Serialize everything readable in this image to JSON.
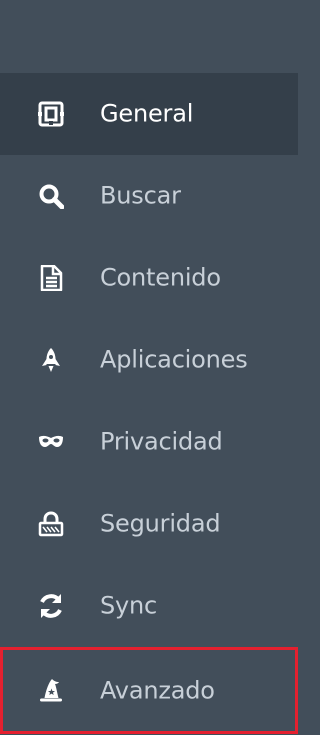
{
  "colors": {
    "sidebar_bg": "#424e5a",
    "selected_bg": "#343f4a",
    "text": "#c8d0d8",
    "selected_text": "#ffffff",
    "highlight_border": "#e4202f"
  },
  "sidebar": {
    "items": [
      {
        "id": "general",
        "label": "General",
        "icon": "general-icon",
        "selected": true
      },
      {
        "id": "buscar",
        "label": "Buscar",
        "icon": "search-icon",
        "selected": false
      },
      {
        "id": "contenido",
        "label": "Contenido",
        "icon": "document-icon",
        "selected": false
      },
      {
        "id": "aplicaciones",
        "label": "Aplicaciones",
        "icon": "rocket-icon",
        "selected": false
      },
      {
        "id": "privacidad",
        "label": "Privacidad",
        "icon": "mask-icon",
        "selected": false
      },
      {
        "id": "seguridad",
        "label": "Seguridad",
        "icon": "lock-icon",
        "selected": false
      },
      {
        "id": "sync",
        "label": "Sync",
        "icon": "sync-icon",
        "selected": false
      },
      {
        "id": "avanzado",
        "label": "Avanzado",
        "icon": "wizard-hat-icon",
        "selected": false,
        "highlighted": true
      }
    ]
  }
}
